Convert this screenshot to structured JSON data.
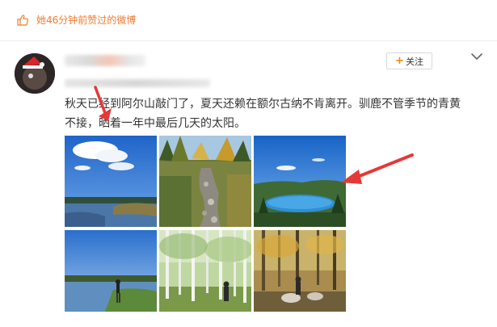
{
  "notice": {
    "text": "她46分钟前赞过的微博",
    "icon": "thumbs-up-icon",
    "color": "#f27a2e"
  },
  "post": {
    "text_line1": "秋天已经到阿尔山敲门了，夏天还赖在额尔古纳不肯离开。驯鹿不管季节的青黄",
    "text_line2": "不接，晒着一年中最后几天的太阳。"
  },
  "follow_button": {
    "label": "关注",
    "plus": "+"
  },
  "more_menu": {
    "icon": "chevron-down-icon"
  },
  "annotations": {
    "arrow_color": "#e53935"
  },
  "photos": [
    {
      "name": "photo-clouds-lake",
      "scene": "blue sky with white clouds over a lake"
    },
    {
      "name": "photo-forest-stream",
      "scene": "autumn forest with rocky stream"
    },
    {
      "name": "photo-mountain-lake",
      "scene": "blue lake surrounded by green forest"
    },
    {
      "name": "photo-river-person",
      "scene": "person standing by a river under blue sky"
    },
    {
      "name": "photo-birch-forest",
      "scene": "birch forest with person"
    },
    {
      "name": "photo-reindeer-camp",
      "scene": "people with reindeer in autumn woods"
    }
  ]
}
